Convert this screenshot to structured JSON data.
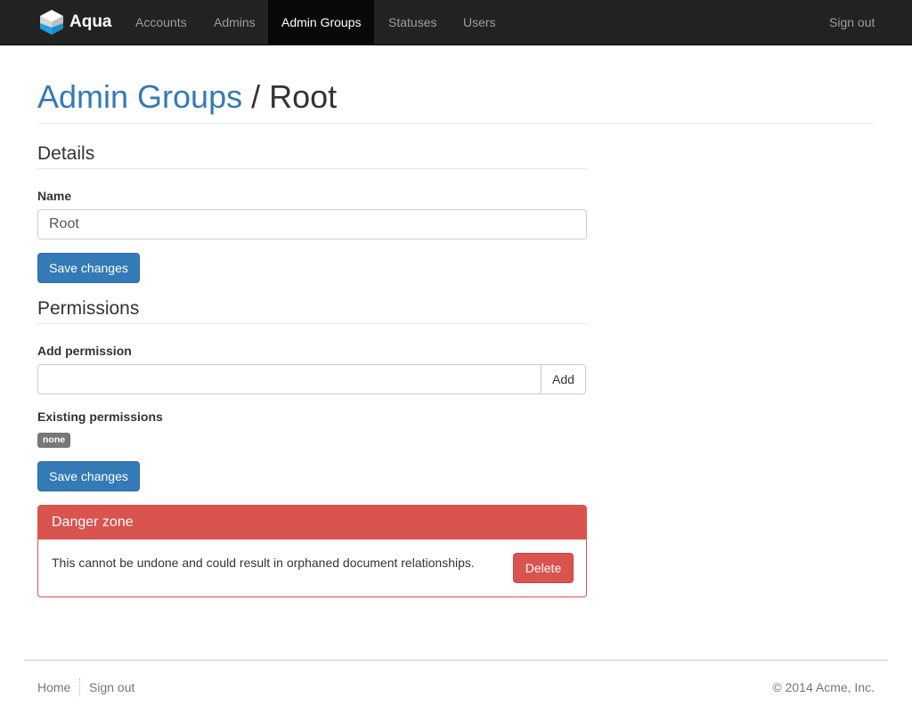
{
  "navbar": {
    "brand": "Aqua",
    "items": [
      {
        "label": "Accounts"
      },
      {
        "label": "Admins"
      },
      {
        "label": "Admin Groups",
        "active": true
      },
      {
        "label": "Statuses"
      },
      {
        "label": "Users"
      }
    ],
    "sign_out": "Sign out",
    "brand_icon": "cube-icon"
  },
  "page": {
    "breadcrumb": "Admin Groups",
    "separator": " / ",
    "title": "Root"
  },
  "details": {
    "heading": "Details",
    "name_label": "Name",
    "name_value": "Root",
    "save_label": "Save changes"
  },
  "permissions": {
    "heading": "Permissions",
    "add_label": "Add permission",
    "add_value": "",
    "add_button": "Add",
    "existing_label": "Existing permissions",
    "none_badge": "none",
    "save_label": "Save changes"
  },
  "danger": {
    "heading": "Danger zone",
    "message": "This cannot be undone and could result in orphaned document relationships.",
    "delete_label": "Delete"
  },
  "footer": {
    "home": "Home",
    "sign_out": "Sign out",
    "copyright": "© 2014 Acme, Inc."
  },
  "colors": {
    "navbar_bg": "#222222",
    "primary": "#337ab7",
    "danger": "#d9534f"
  }
}
